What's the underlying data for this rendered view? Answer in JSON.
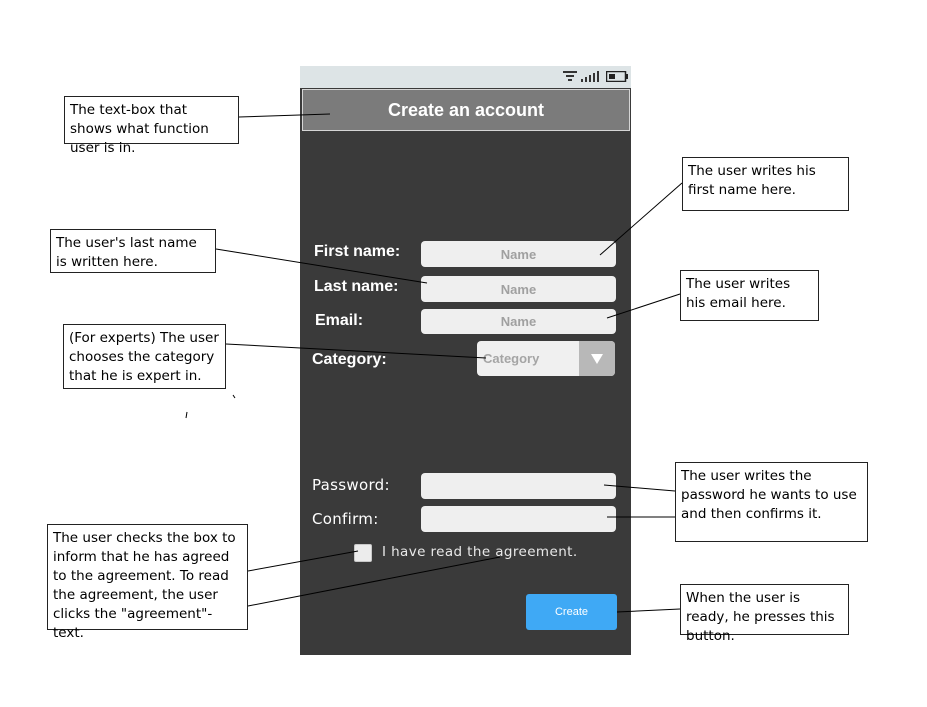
{
  "app": {
    "title": "Create an account"
  },
  "form": {
    "first_name_label": "First name:",
    "first_name_placeholder": "Name",
    "last_name_label": "Last name:",
    "last_name_placeholder": "Name",
    "email_label": "Email:",
    "email_placeholder": "Name",
    "category_label": "Category:",
    "category_value": "Category",
    "password_label": "Password:",
    "confirm_label": "Confirm:",
    "agreement_text": "I have read the agreement.",
    "create_label": "Create"
  },
  "annotations": {
    "title_note": "The text-box that shows what function user is in.",
    "first_name_note": "The user writes his first name here.",
    "last_name_note": "The user's last name is written here.",
    "email_note": "The user writes his email here.",
    "category_note": "(For experts) The user chooses the category that he is expert in.",
    "password_note": "The user writes the password he wants to use and then confirms it.",
    "agreement_note": "The user checks the box to inform that he has agreed to the agreement. To read the agreement, the user clicks the \"agreement\"-text.",
    "create_note": "When the user is ready, he presses this button."
  },
  "colors": {
    "phone_bg": "#3a3a3a",
    "title_bg": "#7b7b7b",
    "status_bg": "#dde4e6",
    "button_bg": "#3fa9f5"
  },
  "icons": {
    "status": [
      "wifi-icon",
      "signal-icon",
      "battery-icon"
    ],
    "dropdown": "triangle-down-icon"
  }
}
